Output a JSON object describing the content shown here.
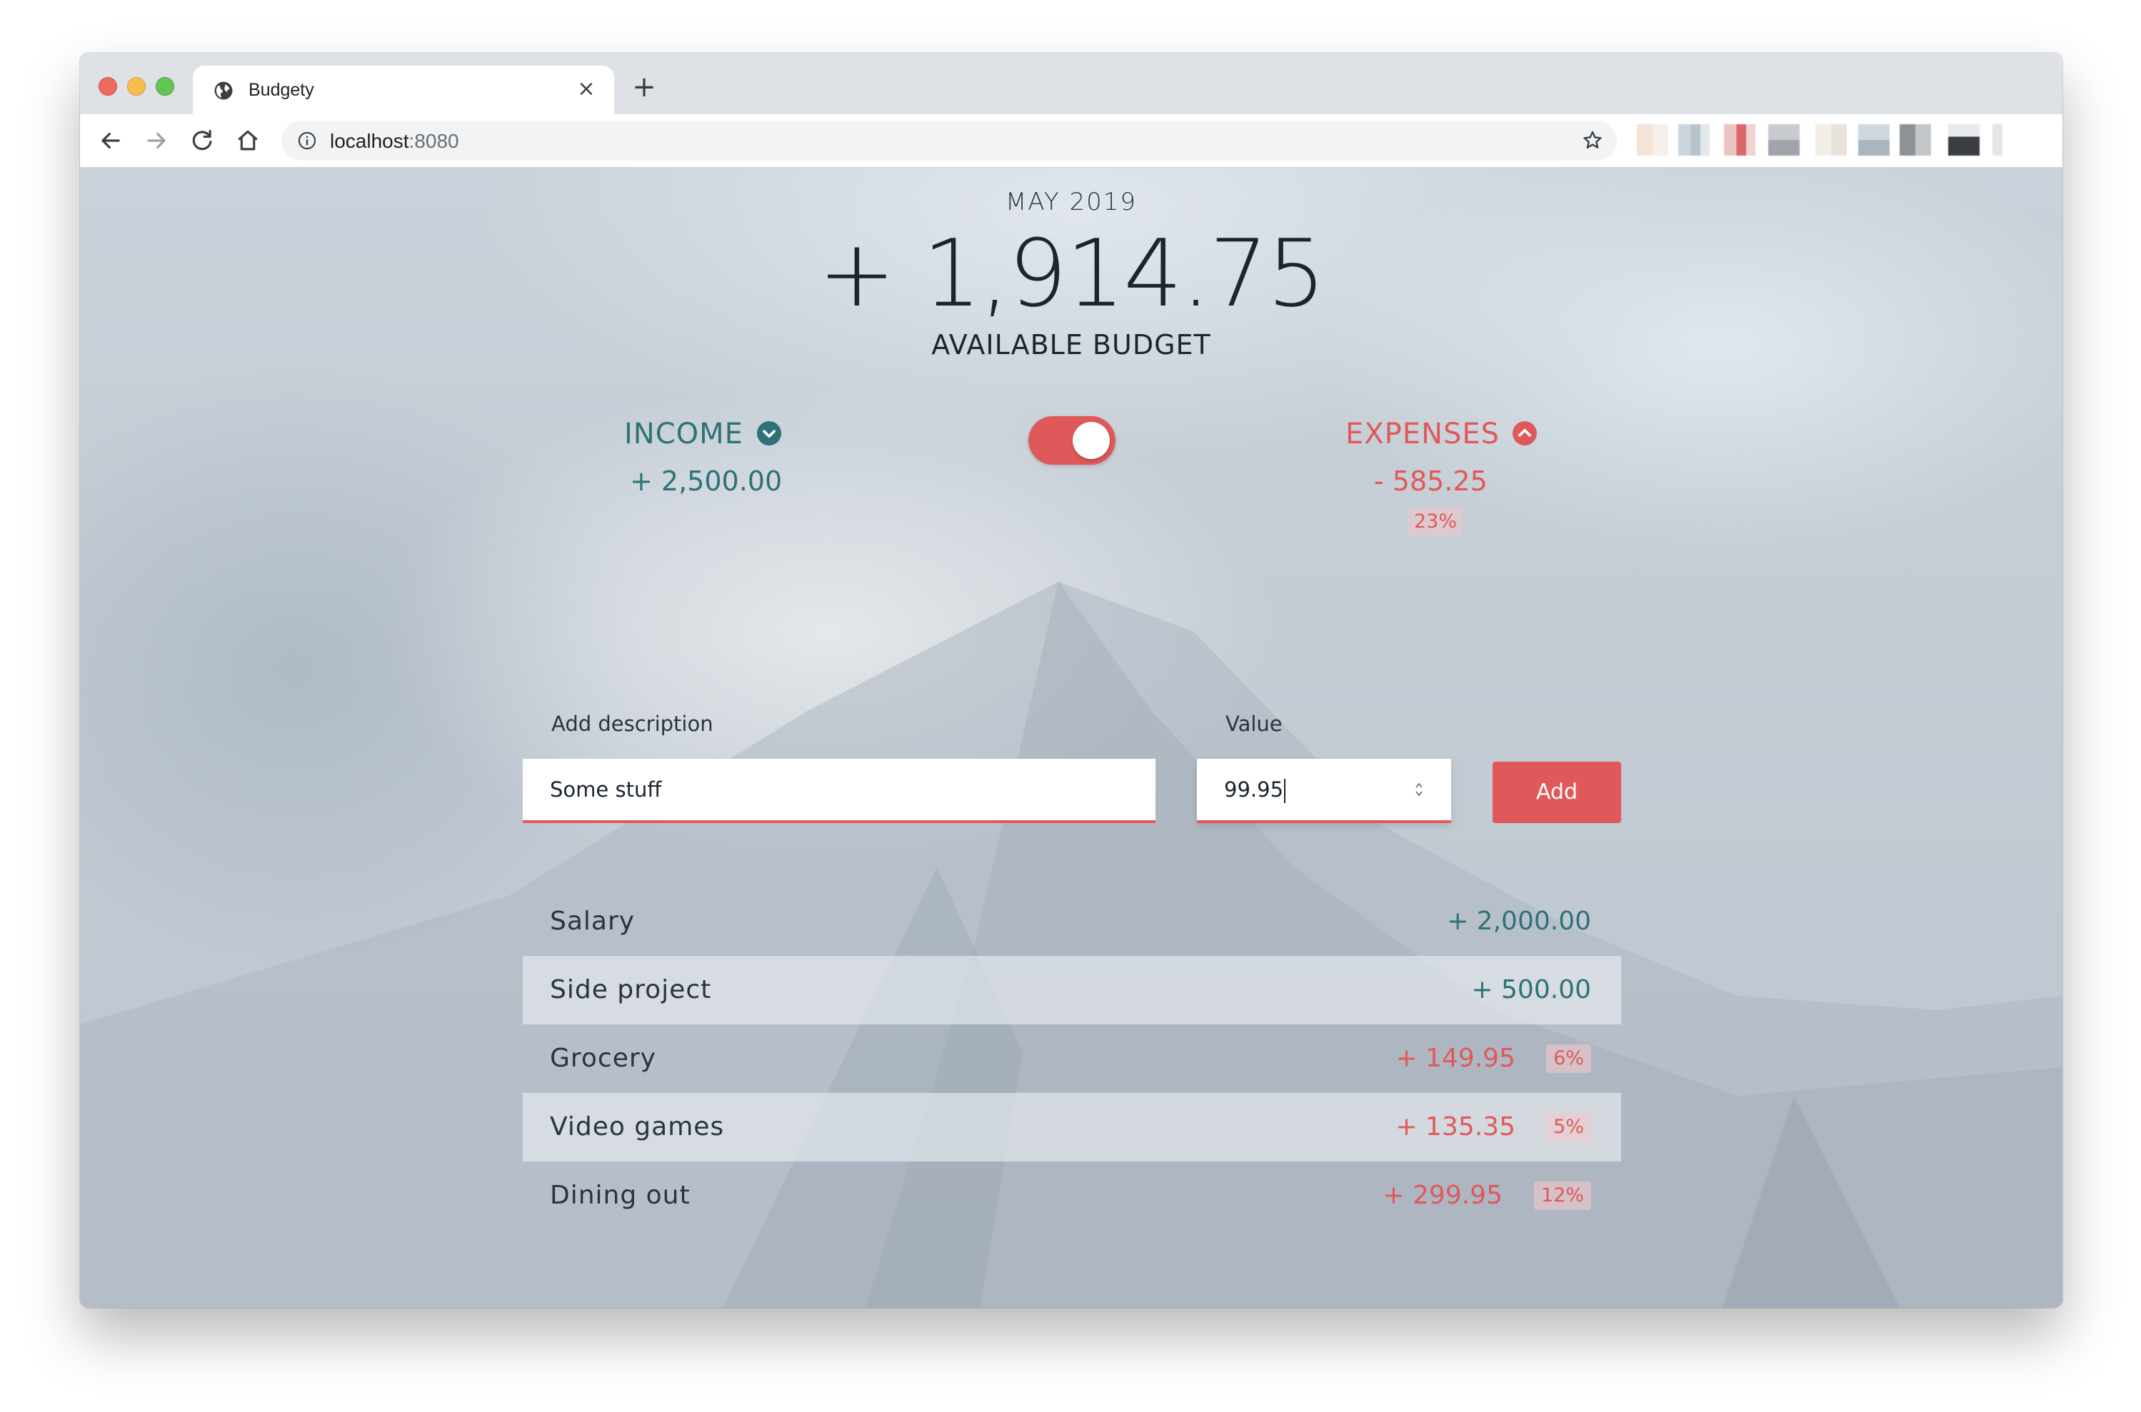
{
  "browser": {
    "tab_title": "Budgety",
    "url_host": "localhost",
    "url_port": ":8080"
  },
  "budget": {
    "month": "MAY 2019",
    "available": "+ 1,914.75",
    "available_label": "AVAILABLE BUDGET"
  },
  "income": {
    "label": "INCOME",
    "value": "+ 2,500.00"
  },
  "expenses": {
    "label": "EXPENSES",
    "value": "- 585.25",
    "percentage": "23%"
  },
  "toggle": {
    "state": "expense"
  },
  "form": {
    "description_label": "Add description",
    "description_value": "Some stuff",
    "value_label": "Value",
    "value_value": "99.95",
    "add_label": "Add"
  },
  "items": [
    {
      "description": "Salary",
      "value": "+ 2,000.00",
      "type": "inc"
    },
    {
      "description": "Side project",
      "value": "+ 500.00",
      "type": "inc"
    },
    {
      "description": "Grocery",
      "value": "+ 149.95",
      "type": "exp",
      "percentage": "6%"
    },
    {
      "description": "Video games",
      "value": "+ 135.35",
      "type": "exp",
      "percentage": "5%"
    },
    {
      "description": "Dining out",
      "value": "+ 299.95",
      "type": "exp",
      "percentage": "12%"
    }
  ],
  "colors": {
    "income": "#2e7277",
    "expense": "#e0595a"
  }
}
